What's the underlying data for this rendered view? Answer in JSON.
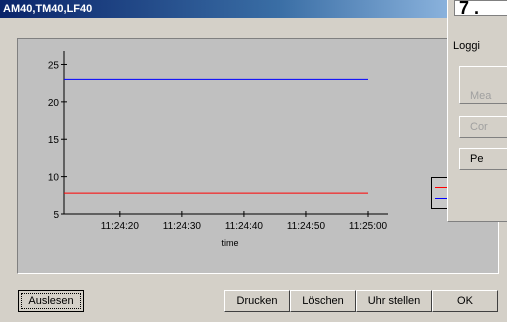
{
  "window": {
    "title": "AM40,TM40,LF40"
  },
  "overlay": {
    "big_text": "7 .",
    "logging_label": "Loggi",
    "btn1": "Mea",
    "btn2": "Cor",
    "btn3": "Pe"
  },
  "buttons": {
    "read": "Auslesen",
    "print": "Drucken",
    "delete": "Löschen",
    "clock": "Uhr stellen",
    "ok": "OK"
  },
  "colors": {
    "series_red": "#ff0000",
    "series_blue": "#0000ff"
  },
  "chart_data": {
    "type": "line",
    "xlabel": "time",
    "ylabel": "",
    "x_ticks": [
      "11:24:20",
      "11:24:30",
      "11:24:40",
      "11:24:50",
      "11:25:00"
    ],
    "y_ticks": [
      5,
      10,
      15,
      20,
      25
    ],
    "ylim": [
      5,
      26
    ],
    "xlim": [
      "11:24:11",
      "11:25:00"
    ],
    "series": [
      {
        "color": "#0000ff",
        "x": [
          "11:24:11",
          "11:25:00"
        ],
        "values": [
          23,
          23
        ]
      },
      {
        "color": "#ff0000",
        "x": [
          "11:24:11",
          "11:25:00"
        ],
        "values": [
          7.8,
          7.8
        ]
      }
    ]
  }
}
